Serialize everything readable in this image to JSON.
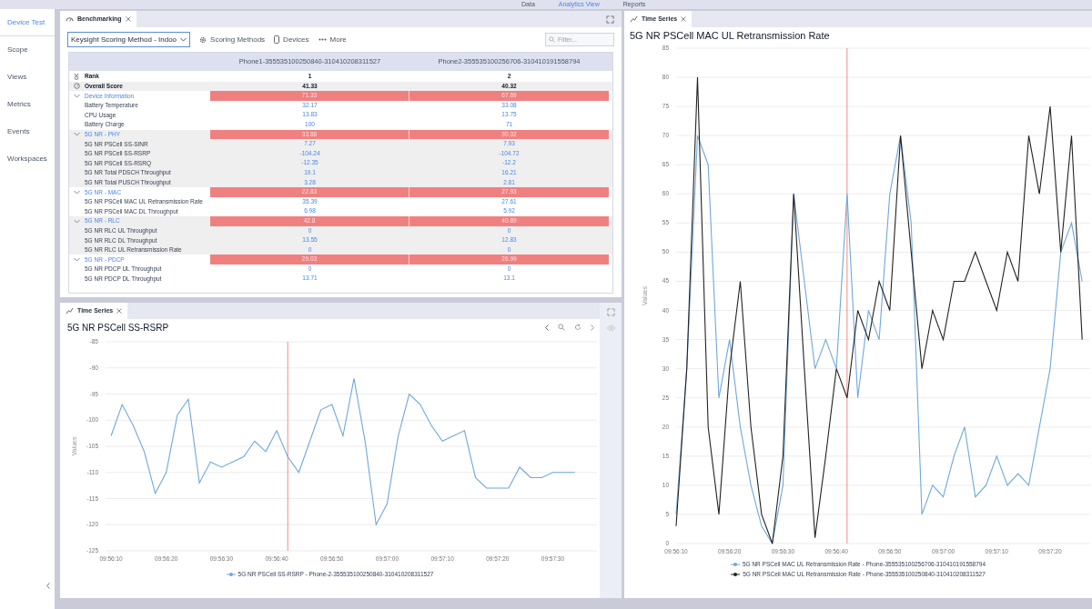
{
  "top_nav": [
    {
      "label": "Data",
      "selected": false
    },
    {
      "label": "Analytics View",
      "selected": true
    },
    {
      "label": "Reports",
      "selected": false
    }
  ],
  "sidebar": {
    "items": [
      {
        "label": "Device Test",
        "selected": true
      },
      {
        "label": "Scope",
        "selected": false
      },
      {
        "label": "Views",
        "selected": false
      },
      {
        "label": "Metrics",
        "selected": false
      },
      {
        "label": "Events",
        "selected": false
      },
      {
        "label": "Workspaces",
        "selected": false
      }
    ]
  },
  "benchmarking": {
    "tab": "Benchmarking",
    "scoring_method": "Keysight Scoring Method - Indoo",
    "toolbar": [
      {
        "kind": "gear",
        "label": "Scoring Methods"
      },
      {
        "kind": "phone",
        "label": "Devices"
      },
      {
        "kind": "more",
        "label": "More"
      }
    ],
    "filter": {
      "placeholder": "Filter..."
    },
    "table": {
      "columns": [
        "Phone1-355535100250840-310410208311527",
        "Phone2-355535100256706-310410191558794"
      ],
      "rank": {
        "label": "Rank",
        "values": [
          "1",
          "2"
        ]
      },
      "overall": {
        "label": "Overall Score",
        "values": [
          "41.33",
          "40.32"
        ]
      },
      "groups": [
        {
          "label": "Device Information",
          "expanded": true,
          "values": [
            "71.33",
            "67.69"
          ],
          "metrics": [
            {
              "label": "Battery Temperature",
              "values": [
                "32.17",
                "33.08"
              ]
            },
            {
              "label": "CPU Usage",
              "values": [
                "13.83",
                "13.75"
              ]
            },
            {
              "label": "Battery Charge",
              "values": [
                "100",
                "71"
              ]
            }
          ]
        },
        {
          "label": "5G NR - PHY",
          "expanded": true,
          "values": [
            "33.88",
            "30.32"
          ],
          "metrics": [
            {
              "label": "5G NR PSCell SS-SINR",
              "values": [
                "7.27",
                "7.93"
              ]
            },
            {
              "label": "5G NR PSCell SS-RSRP",
              "values": [
                "-104.24",
                "-104.72"
              ]
            },
            {
              "label": "5G NR PSCell SS-RSRQ",
              "values": [
                "-12.35",
                "-12.2"
              ]
            },
            {
              "label": "5G NR Total PDSCH Throughput",
              "values": [
                "19.1",
                "16.21"
              ]
            },
            {
              "label": "5G NR Total PUSCH Throughput",
              "values": [
                "3.28",
                "2.81"
              ]
            }
          ]
        },
        {
          "label": "5G NR - MAC",
          "expanded": true,
          "values": [
            "22.83",
            "27.93"
          ],
          "metrics": [
            {
              "label": "5G NR PSCell MAC UL Retransmission Rate",
              "values": [
                "35.39",
                "27.61"
              ]
            },
            {
              "label": "5G NR PSCell MAC DL Throughput",
              "values": [
                "6.98",
                "5.92"
              ]
            }
          ]
        },
        {
          "label": "5G NR - RLC",
          "expanded": true,
          "values": [
            "42.8",
            "40.89"
          ],
          "metrics": [
            {
              "label": "5G NR RLC UL Throughput",
              "values": [
                "0",
                "0"
              ]
            },
            {
              "label": "5G NR RLC DL Throughput",
              "values": [
                "13.55",
                "12.83"
              ]
            },
            {
              "label": "5G NR RLC UL Retransmission Rate",
              "values": [
                "0",
                "0"
              ]
            }
          ]
        },
        {
          "label": "5G NR - PDCP",
          "expanded": true,
          "values": [
            "29.03",
            "26.99"
          ],
          "metrics": [
            {
              "label": "5G NR PDCP UL Throughput",
              "values": [
                "0",
                "0"
              ]
            },
            {
              "label": "5G NR PDCP DL Throughput",
              "values": [
                "13.71",
                "13.1"
              ]
            }
          ]
        }
      ]
    }
  },
  "time_series_left": {
    "tab": "Time Series",
    "chart_data": {
      "type": "line",
      "title": "5G NR PSCell SS-RSRP",
      "ylabel": "Values",
      "categories": [
        "09:56:10",
        null,
        null,
        null,
        null,
        "09:56:20",
        null,
        null,
        null,
        null,
        "09:56:30",
        null,
        null,
        null,
        null,
        "09:56:40",
        null,
        null,
        null,
        null,
        "09:56:50",
        null,
        null,
        null,
        null,
        "09:57:00",
        null,
        null,
        null,
        null,
        "09:57:10",
        null,
        null,
        null,
        null,
        "09:57:20",
        null,
        null,
        null,
        null,
        "09:57:30",
        null,
        null
      ],
      "series": [
        {
          "name": "5G NR PSCell SS-RSRP - Phone-2-355535100250840-310410208311527",
          "color": "#6fa8dc",
          "values": [
            -103,
            -97,
            -101,
            -106,
            -114,
            -110,
            -99,
            -96,
            -112,
            -108,
            -109,
            -108,
            -107,
            -104,
            -106,
            -102,
            -107,
            -110,
            -104,
            -98,
            -97,
            -103,
            -92,
            -104,
            -120,
            -116,
            -103,
            -95,
            -97,
            -101,
            -104,
            -103,
            -102,
            -111,
            -113,
            -113,
            -113,
            -109,
            -111,
            -111,
            -110,
            -110,
            -110
          ]
        }
      ],
      "ylim": [
        -125,
        -85
      ],
      "yticks": [
        -125,
        -120,
        -115,
        -110,
        -105,
        -100,
        -95,
        -90,
        -85
      ],
      "grid": true
    }
  },
  "time_series_right": {
    "tab": "Time Series",
    "chart_data": {
      "type": "line",
      "title": "5G NR PSCell MAC UL Retransmission Rate",
      "ylabel": "Values",
      "categories": [
        "09:56:10",
        null,
        null,
        null,
        null,
        "09:56:20",
        null,
        null,
        null,
        null,
        "09:56:30",
        null,
        null,
        null,
        null,
        "09:56:40",
        null,
        null,
        null,
        null,
        "09:56:50",
        null,
        null,
        null,
        null,
        "09:57:00",
        null,
        null,
        null,
        null,
        "09:57:10",
        null,
        null,
        null,
        null,
        "09:57:20",
        null,
        null,
        null
      ],
      "series": [
        {
          "name": "5G NR PSCell MAC UL Retransmission Rate - Phone-355535100256706-310410191558794",
          "color": "#6fa8dc",
          "values": [
            5,
            30,
            70,
            65,
            25,
            35,
            20,
            10,
            3,
            0,
            10,
            60,
            45,
            30,
            35,
            30,
            60,
            25,
            40,
            35,
            60,
            70,
            55,
            5,
            10,
            8,
            15,
            20,
            8,
            10,
            15,
            10,
            12,
            10,
            20,
            30,
            50,
            55,
            45
          ]
        },
        {
          "name": "5G NR PSCell MAC UL Retransmission Rate - Phone-355535100250840-310410208311527",
          "color": "#222222",
          "values": [
            3,
            30,
            80,
            20,
            5,
            30,
            45,
            20,
            5,
            0,
            15,
            60,
            30,
            1,
            15,
            30,
            25,
            40,
            35,
            45,
            40,
            70,
            50,
            30,
            40,
            35,
            45,
            45,
            50,
            45,
            40,
            50,
            45,
            70,
            60,
            75,
            50,
            70,
            35
          ]
        }
      ],
      "ylim": [
        0,
        85
      ],
      "yticks": [
        0,
        5,
        10,
        15,
        20,
        25,
        30,
        35,
        40,
        45,
        50,
        55,
        60,
        65,
        70,
        75,
        80,
        85
      ],
      "grid": true
    }
  }
}
